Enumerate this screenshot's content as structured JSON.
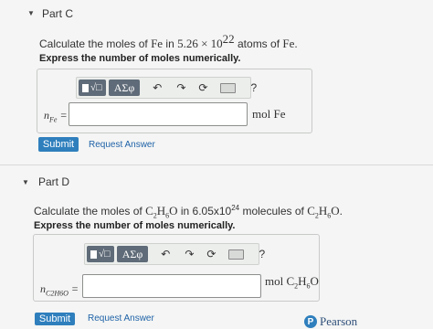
{
  "partC": {
    "title": "Part C",
    "q_prefix": "Calculate the moles of ",
    "q_element": "Fe",
    "q_in": " in ",
    "q_mantissa": "5.26 × 10",
    "q_exp": "22",
    "q_atoms": " atoms of ",
    "q_element2": "Fe",
    "q_end": ".",
    "instruction": "Express the number of moles numerically.",
    "var_base": "n",
    "var_sub": "Fe",
    "var_eq": " =",
    "input_value": "",
    "unit": "mol Fe",
    "submit_label": "Submit",
    "request_label": "Request Answer"
  },
  "partD": {
    "title": "Part D",
    "q_prefix": "Calculate the moles of ",
    "q_formula_a": "C",
    "q_formula_a_sub": "2",
    "q_formula_b": "H",
    "q_formula_b_sub": "6",
    "q_formula_c": "O",
    "q_in": " in 6.05x10",
    "q_exp": "24",
    "q_molecules": " molecules of ",
    "q_end": ".",
    "instruction": "Express the number of moles numerically.",
    "var_base": "n",
    "var_sub": "C2H6O",
    "var_eq": " =",
    "input_value": "",
    "unit": "mol C",
    "unit_sub1": "2",
    "unit_h": "H",
    "unit_sub2": "6",
    "unit_o": "O",
    "submit_label": "Submit",
    "request_label": "Request Answer"
  },
  "toolbar": {
    "greek_label": "AΣφ",
    "help_label": "?",
    "icons": [
      "templates-icon",
      "greek-icon",
      "undo-icon",
      "redo-icon",
      "reset-icon",
      "keyboard-icon",
      "help-icon"
    ]
  },
  "footer": {
    "brand": "Pearson"
  },
  "colors": {
    "submit": "#2f7fbd",
    "link": "#1f62a8",
    "background": "#f4f5f4"
  }
}
